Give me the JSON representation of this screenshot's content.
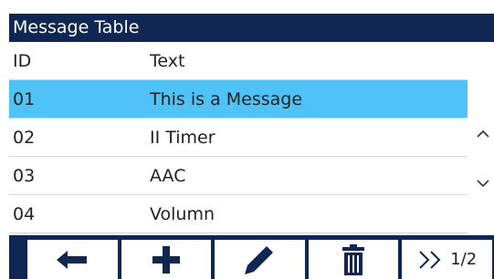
{
  "title": "Message Table",
  "table": {
    "headers": {
      "id": "ID",
      "text": "Text"
    },
    "rows": [
      {
        "id": "01",
        "text": "This is a Message",
        "selected": true
      },
      {
        "id": "02",
        "text": "II Timer",
        "selected": false
      },
      {
        "id": "03",
        "text": "AAC",
        "selected": false
      },
      {
        "id": "04",
        "text": "Volumn",
        "selected": false
      }
    ]
  },
  "scroll": {
    "up_icon": "chevron-up-icon",
    "down_icon": "chevron-down-icon"
  },
  "toolbar": {
    "buttons": [
      {
        "icon": "back-arrow-icon"
      },
      {
        "icon": "plus-icon"
      },
      {
        "icon": "pencil-icon"
      },
      {
        "icon": "trash-icon"
      },
      {
        "icon": "next-page-icon",
        "label": "1/2"
      }
    ]
  },
  "colors": {
    "header_bg": "#0f2752",
    "selected_row": "#4fc3f7",
    "text": "#222222",
    "icon": "#0f2752"
  }
}
